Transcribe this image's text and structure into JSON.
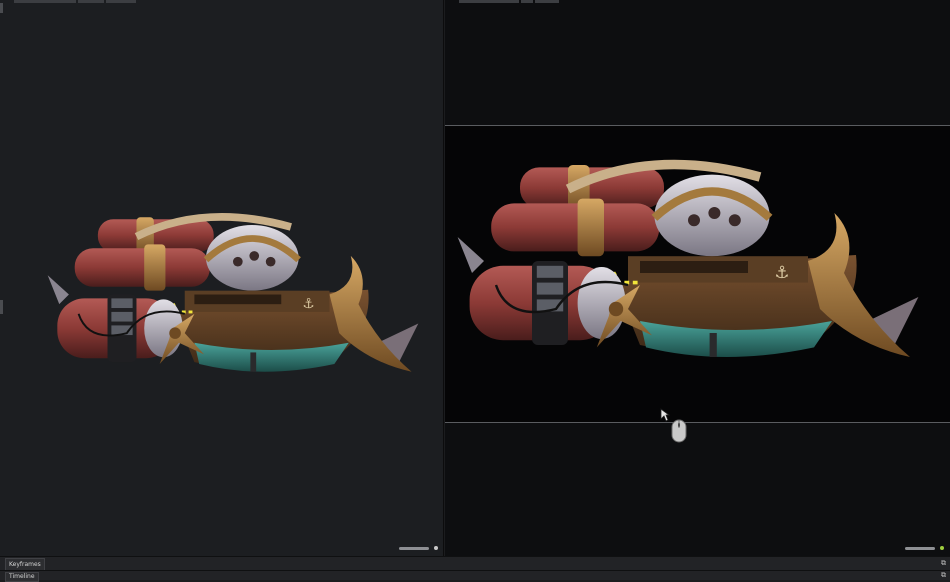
{
  "panels": {
    "keyframes_label": "Keyframes",
    "timeline_label": "Timeline"
  },
  "viewports": {
    "left": {
      "shading": "realtime-viewport",
      "zoom": 0.5
    },
    "right": {
      "shading": "path-traced-render",
      "zoom": 0.5,
      "status_color": "#9fce3f"
    }
  },
  "icons": {
    "expand": "expand-icon",
    "mouse": "mouse-icon",
    "cursor": "cursor-arrow-icon"
  },
  "colors": {
    "viewport_bg": "#1c1e21",
    "render_bg": "#050506",
    "hull_red": "#8c3a36",
    "brass": "#a47a3d",
    "teal": "#2f7d77"
  }
}
